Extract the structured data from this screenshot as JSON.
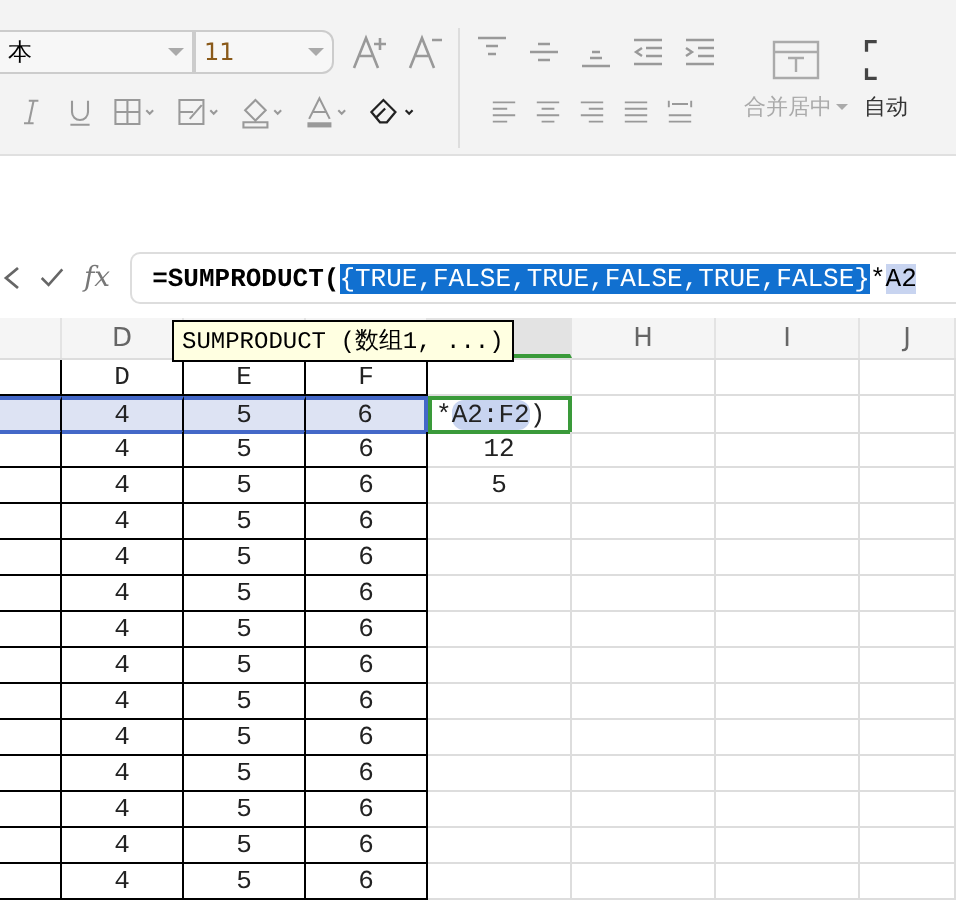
{
  "ribbon": {
    "font_name": "本",
    "font_size": "11",
    "merge_button": "合并居中",
    "wrap_button": "自动"
  },
  "formula_bar": {
    "function_label": "fx",
    "segments": [
      {
        "kind": "plain",
        "text": "=SUMPRODUCT("
      },
      {
        "kind": "selected",
        "text": "{TRUE,FALSE,TRUE,FALSE,TRUE,FALSE}"
      },
      {
        "kind": "plain",
        "text": "*"
      },
      {
        "kind": "ref",
        "text": "A2"
      }
    ]
  },
  "tooltip": {
    "text": "SUMPRODUCT (数组1, ...)"
  },
  "grid": {
    "columns": [
      {
        "label": "D",
        "selected": false
      },
      {
        "selected": false
      },
      {
        "selected": false
      },
      {
        "selected": true
      },
      {
        "label": "H",
        "selected": false
      },
      {
        "label": "I",
        "selected": false
      },
      {
        "label": "J",
        "selected": false
      }
    ],
    "rows": [
      {
        "selected": false,
        "cells": [
          "D",
          "E",
          "F"
        ]
      },
      {
        "selected": true,
        "cells": [
          "4",
          "5",
          "6"
        ],
        "editing": [
          {
            "kind": "plain",
            "text": "*"
          },
          {
            "kind": "ref",
            "text": "A2:F2"
          },
          {
            "kind": "plain",
            "text": ")"
          }
        ]
      },
      {
        "selected": false,
        "cells": [
          "4",
          "5",
          "6"
        ],
        "result": "12"
      },
      {
        "selected": false,
        "cells": [
          "4",
          "5",
          "6"
        ],
        "result": "5"
      },
      {
        "selected": false,
        "cells": [
          "4",
          "5",
          "6"
        ]
      },
      {
        "selected": false,
        "cells": [
          "4",
          "5",
          "6"
        ]
      },
      {
        "selected": false,
        "cells": [
          "4",
          "5",
          "6"
        ]
      },
      {
        "selected": false,
        "cells": [
          "4",
          "5",
          "6"
        ]
      },
      {
        "selected": false,
        "cells": [
          "4",
          "5",
          "6"
        ]
      },
      {
        "selected": false,
        "cells": [
          "4",
          "5",
          "6"
        ]
      },
      {
        "selected": false,
        "cells": [
          "4",
          "5",
          "6"
        ]
      },
      {
        "selected": false,
        "cells": [
          "4",
          "5",
          "6"
        ]
      },
      {
        "selected": false,
        "cells": [
          "4",
          "5",
          "6"
        ]
      },
      {
        "selected": false,
        "cells": [
          "4",
          "5",
          "6"
        ]
      },
      {
        "selected": false,
        "cells": [
          "4",
          "5",
          "6"
        ]
      }
    ]
  }
}
